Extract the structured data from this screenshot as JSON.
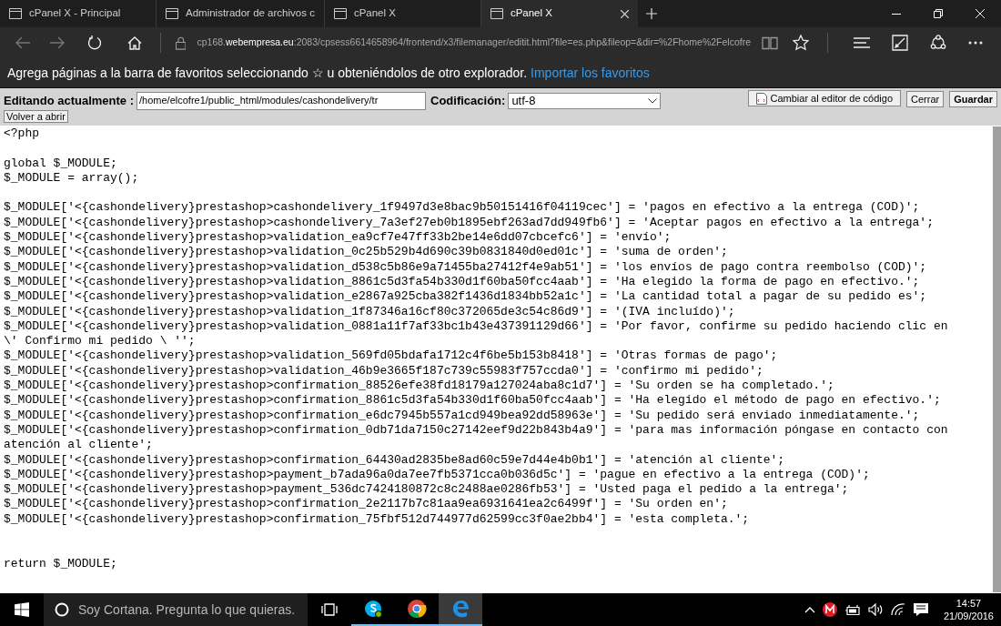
{
  "browser": {
    "tabs": [
      {
        "title": "cPanel X - Principal",
        "selected": false
      },
      {
        "title": "Administrador de archivos c",
        "selected": false
      },
      {
        "title": "cPanel X",
        "selected": false
      },
      {
        "title": "cPanel X",
        "selected": true
      }
    ],
    "url": "cp168.**webempresa.eu**:2083/cpsess6614658964/frontend/x3/filemanager/editit.html?file=es.php&fileop=&dir=%2Fhome%2Felcofre",
    "favorites_bar": {
      "message": "Agrega páginas a la barra de favoritos seleccionando ☆ u obteniéndolos de otro explorador.",
      "link": "Importar los favoritos"
    }
  },
  "editor": {
    "label": "Editando actualmente :",
    "path": "/home/elcofre1/public_html/modules/cashondelivery/tr",
    "encoding_label": "Codificación:",
    "encoding": "utf-8",
    "buttons": [
      {
        "kind": "switch",
        "label": "Cambiar al editor de código"
      },
      {
        "kind": "close",
        "label": "Cerrar"
      },
      {
        "kind": "save",
        "label": "Guardar"
      }
    ],
    "reopen": "Volver a abrir",
    "content": "<?php\n\nglobal $_MODULE;\n$_MODULE = array();\n\n$_MODULE['<{cashondelivery}prestashop>cashondelivery_1f9497d3e8bac9b50151416f04119cec'] = 'pagos en efectivo a la entrega (COD)';\n$_MODULE['<{cashondelivery}prestashop>cashondelivery_7a3ef27eb0b1895ebf263ad7dd949fb6'] = 'Aceptar pagos en efectivo a la entrega';\n$_MODULE['<{cashondelivery}prestashop>validation_ea9cf7e47ff33b2be14e6dd07cbcefc6'] = 'envío';\n$_MODULE['<{cashondelivery}prestashop>validation_0c25b529b4d690c39b0831840d0ed01c'] = 'suma de orden';\n$_MODULE['<{cashondelivery}prestashop>validation_d538c5b86e9a71455ba27412f4e9ab51'] = 'los envíos de pago contra reembolso (COD)';\n$_MODULE['<{cashondelivery}prestashop>validation_8861c5d3fa54b330d1f60ba50fcc4aab'] = 'Ha elegido la forma de pago en efectivo.';\n$_MODULE['<{cashondelivery}prestashop>validation_e2867a925cba382f1436d1834bb52a1c'] = 'La cantidad total a pagar de su pedido es';\n$_MODULE['<{cashondelivery}prestashop>validation_1f87346a16cf80c372065de3c54c86d9'] = '(IVA incluído)';\n$_MODULE['<{cashondelivery}prestashop>validation_0881a11f7af33bc1b43e437391129d66'] = 'Por favor, confirme su pedido haciendo clic en\n\\' Confirmo mi pedido \\ '';\n$_MODULE['<{cashondelivery}prestashop>validation_569fd05bdafa1712c4f6be5b153b8418'] = 'Otras formas de pago';\n$_MODULE['<{cashondelivery}prestashop>validation_46b9e3665f187c739c55983f757ccda0'] = 'confirmo mi pedido';\n$_MODULE['<{cashondelivery}prestashop>confirmation_88526efe38fd18179a127024aba8c1d7'] = 'Su orden se ha completado.';\n$_MODULE['<{cashondelivery}prestashop>confirmation_8861c5d3fa54b330d1f60ba50fcc4aab'] = 'Ha elegido el método de pago en efectivo.';\n$_MODULE['<{cashondelivery}prestashop>confirmation_e6dc7945b557a1cd949bea92dd58963e'] = 'Su pedido será enviado inmediatamente.';\n$_MODULE['<{cashondelivery}prestashop>confirmation_0db71da7150c27142eef9d22b843b4a9'] = 'para mas información póngase en contacto con\natención al cliente';\n$_MODULE['<{cashondelivery}prestashop>confirmation_64430ad2835be8ad60c59e7d44e4b0b1'] = 'atención al cliente';\n$_MODULE['<{cashondelivery}prestashop>payment_b7ada96a0da7ee7fb5371cca0b036d5c'] = 'pague en efectivo a la entrega (COD)';\n$_MODULE['<{cashondelivery}prestashop>payment_536dc7424180872c8c2488ae0286fb53'] = 'Usted paga el pedido a la entrega';\n$_MODULE['<{cashondelivery}prestashop>confirmation_2e2117b7c81aa9ea6931641ea2c6499f'] = 'Su orden en';\n$_MODULE['<{cashondelivery}prestashop>confirmation_75fbf512d744977d62599cc3f0ae2bb4'] = 'esta completa.';\n\n\nreturn $_MODULE;"
  },
  "taskbar": {
    "search_placeholder": "Soy Cortana. Pregunta lo que quieras.",
    "apps": [
      {
        "kind": "skype",
        "running": true,
        "selected": false
      },
      {
        "kind": "chrome",
        "running": true,
        "selected": false
      },
      {
        "kind": "edge",
        "running": true,
        "selected": true
      }
    ],
    "time": "14:57",
    "date": "21/09/2016"
  }
}
